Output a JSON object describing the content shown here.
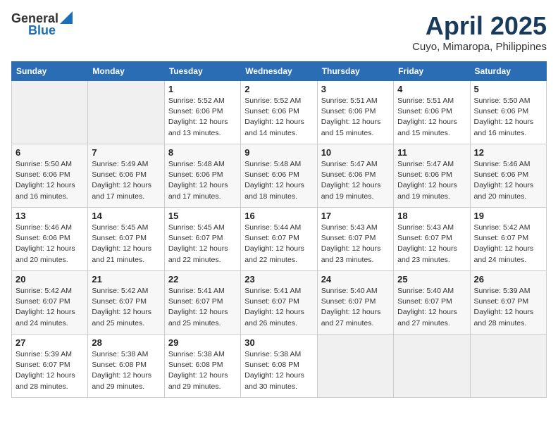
{
  "header": {
    "logo_general": "General",
    "logo_blue": "Blue",
    "month_title": "April 2025",
    "subtitle": "Cuyo, Mimaropa, Philippines"
  },
  "weekdays": [
    "Sunday",
    "Monday",
    "Tuesday",
    "Wednesday",
    "Thursday",
    "Friday",
    "Saturday"
  ],
  "weeks": [
    [
      null,
      null,
      {
        "day": 1,
        "sunrise": "5:52 AM",
        "sunset": "6:06 PM",
        "daylight": "12 hours and 13 minutes."
      },
      {
        "day": 2,
        "sunrise": "5:52 AM",
        "sunset": "6:06 PM",
        "daylight": "12 hours and 14 minutes."
      },
      {
        "day": 3,
        "sunrise": "5:51 AM",
        "sunset": "6:06 PM",
        "daylight": "12 hours and 15 minutes."
      },
      {
        "day": 4,
        "sunrise": "5:51 AM",
        "sunset": "6:06 PM",
        "daylight": "12 hours and 15 minutes."
      },
      {
        "day": 5,
        "sunrise": "5:50 AM",
        "sunset": "6:06 PM",
        "daylight": "12 hours and 16 minutes."
      }
    ],
    [
      {
        "day": 6,
        "sunrise": "5:50 AM",
        "sunset": "6:06 PM",
        "daylight": "12 hours and 16 minutes."
      },
      {
        "day": 7,
        "sunrise": "5:49 AM",
        "sunset": "6:06 PM",
        "daylight": "12 hours and 17 minutes."
      },
      {
        "day": 8,
        "sunrise": "5:48 AM",
        "sunset": "6:06 PM",
        "daylight": "12 hours and 17 minutes."
      },
      {
        "day": 9,
        "sunrise": "5:48 AM",
        "sunset": "6:06 PM",
        "daylight": "12 hours and 18 minutes."
      },
      {
        "day": 10,
        "sunrise": "5:47 AM",
        "sunset": "6:06 PM",
        "daylight": "12 hours and 19 minutes."
      },
      {
        "day": 11,
        "sunrise": "5:47 AM",
        "sunset": "6:06 PM",
        "daylight": "12 hours and 19 minutes."
      },
      {
        "day": 12,
        "sunrise": "5:46 AM",
        "sunset": "6:06 PM",
        "daylight": "12 hours and 20 minutes."
      }
    ],
    [
      {
        "day": 13,
        "sunrise": "5:46 AM",
        "sunset": "6:06 PM",
        "daylight": "12 hours and 20 minutes."
      },
      {
        "day": 14,
        "sunrise": "5:45 AM",
        "sunset": "6:07 PM",
        "daylight": "12 hours and 21 minutes."
      },
      {
        "day": 15,
        "sunrise": "5:45 AM",
        "sunset": "6:07 PM",
        "daylight": "12 hours and 22 minutes."
      },
      {
        "day": 16,
        "sunrise": "5:44 AM",
        "sunset": "6:07 PM",
        "daylight": "12 hours and 22 minutes."
      },
      {
        "day": 17,
        "sunrise": "5:43 AM",
        "sunset": "6:07 PM",
        "daylight": "12 hours and 23 minutes."
      },
      {
        "day": 18,
        "sunrise": "5:43 AM",
        "sunset": "6:07 PM",
        "daylight": "12 hours and 23 minutes."
      },
      {
        "day": 19,
        "sunrise": "5:42 AM",
        "sunset": "6:07 PM",
        "daylight": "12 hours and 24 minutes."
      }
    ],
    [
      {
        "day": 20,
        "sunrise": "5:42 AM",
        "sunset": "6:07 PM",
        "daylight": "12 hours and 24 minutes."
      },
      {
        "day": 21,
        "sunrise": "5:42 AM",
        "sunset": "6:07 PM",
        "daylight": "12 hours and 25 minutes."
      },
      {
        "day": 22,
        "sunrise": "5:41 AM",
        "sunset": "6:07 PM",
        "daylight": "12 hours and 25 minutes."
      },
      {
        "day": 23,
        "sunrise": "5:41 AM",
        "sunset": "6:07 PM",
        "daylight": "12 hours and 26 minutes."
      },
      {
        "day": 24,
        "sunrise": "5:40 AM",
        "sunset": "6:07 PM",
        "daylight": "12 hours and 27 minutes."
      },
      {
        "day": 25,
        "sunrise": "5:40 AM",
        "sunset": "6:07 PM",
        "daylight": "12 hours and 27 minutes."
      },
      {
        "day": 26,
        "sunrise": "5:39 AM",
        "sunset": "6:07 PM",
        "daylight": "12 hours and 28 minutes."
      }
    ],
    [
      {
        "day": 27,
        "sunrise": "5:39 AM",
        "sunset": "6:07 PM",
        "daylight": "12 hours and 28 minutes."
      },
      {
        "day": 28,
        "sunrise": "5:38 AM",
        "sunset": "6:08 PM",
        "daylight": "12 hours and 29 minutes."
      },
      {
        "day": 29,
        "sunrise": "5:38 AM",
        "sunset": "6:08 PM",
        "daylight": "12 hours and 29 minutes."
      },
      {
        "day": 30,
        "sunrise": "5:38 AM",
        "sunset": "6:08 PM",
        "daylight": "12 hours and 30 minutes."
      },
      null,
      null,
      null
    ]
  ]
}
